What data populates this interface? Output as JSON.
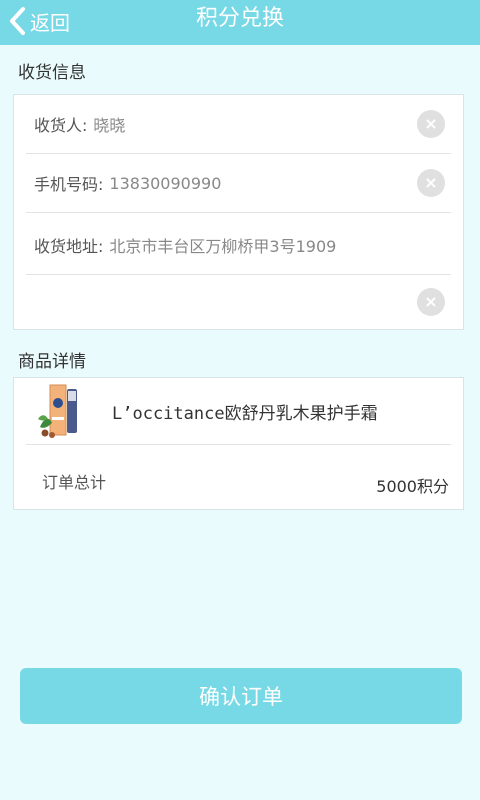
{
  "header": {
    "back_label": "返回",
    "title": "积分兑换"
  },
  "shipping": {
    "section_title": "收货信息",
    "recipient_label": "收货人:",
    "recipient_value": "晓晓",
    "phone_label": "手机号码:",
    "phone_value": "13830090990",
    "address_label": "收货地址:",
    "address_value": "北京市丰台区万柳桥甲3号1909",
    "address_line2_value": ""
  },
  "product": {
    "section_title": "商品详情",
    "name": "L’occitance欧舒丹乳木果护手霜",
    "total_label": "订单总计",
    "total_value": "5000积分"
  },
  "confirm_label": "确认订单",
  "colors": {
    "accent": "#78d9e6",
    "background": "#eafbfd"
  }
}
